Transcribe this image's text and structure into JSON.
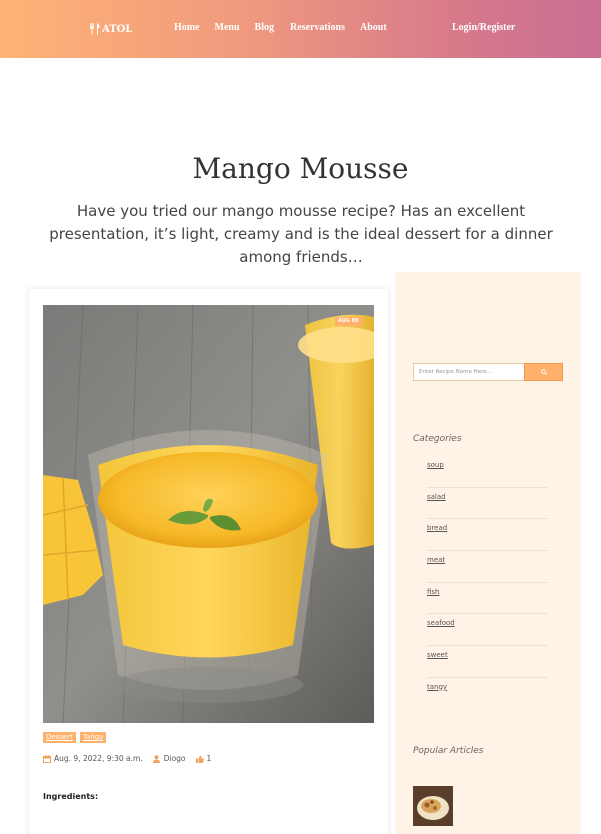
{
  "nav": {
    "brand": "ATOL",
    "links": [
      "Home",
      "Menu",
      "Blog",
      "Reservations",
      "About"
    ],
    "login": "Login/Register"
  },
  "hero": {
    "title": "Mango Mousse",
    "subtitle": "Have you tried our mango mousse recipe? Has an excellent presentation, it’s light, creamy and is the ideal dessert for a dinner among friends…"
  },
  "article": {
    "date_badge": "AUG 09",
    "tags": [
      "Dessert",
      "Tangy"
    ],
    "date": "Aug. 9, 2022, 9:30 a.m.",
    "author": "Diogo",
    "likes": "1",
    "ingredients_label": "Ingredients:"
  },
  "sidebar": {
    "search_placeholder": "Enter Recipe Name Here...",
    "categories_heading": "Categories",
    "categories": [
      "soup",
      "salad",
      "bread",
      "meat",
      "fish",
      "seafood",
      "sweet",
      "tangy"
    ],
    "popular_heading": "Popular Articles"
  },
  "colors": {
    "accent": "#ffb06b",
    "sidebar_bg": "#fff3e7",
    "nav_start": "#ffb375",
    "nav_end": "#c86f93"
  }
}
